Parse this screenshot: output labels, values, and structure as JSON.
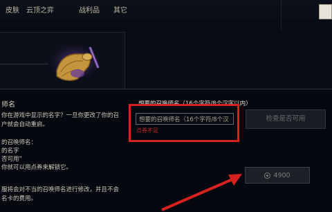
{
  "nav": {
    "tabs": [
      "皮肤",
      "云顶之弈",
      "战利品",
      "其它"
    ]
  },
  "dialog": {
    "left_title": "师名",
    "left_lines": [
      "你在游戏中显示的名字？一旦你更改了你的召",
      "户就会自动重启。",
      "的召唤师名：",
      "的名字",
      "否可用”",
      "你就可以用点券来解锁它。",
      "服将会对不当的召唤师名进行修改，并且不会",
      "名卡的费用。"
    ],
    "field_label": "想要的召唤师名（16个字符/8个汉字以内）",
    "input_value": "想要的召唤师名（16个字符/8个汉",
    "error_text": "点券不足",
    "check_button": "检查是否可用",
    "price": "4900"
  },
  "colors": {
    "highlight": "#d6211f",
    "error": "#c62a24",
    "background": "#05080f"
  }
}
